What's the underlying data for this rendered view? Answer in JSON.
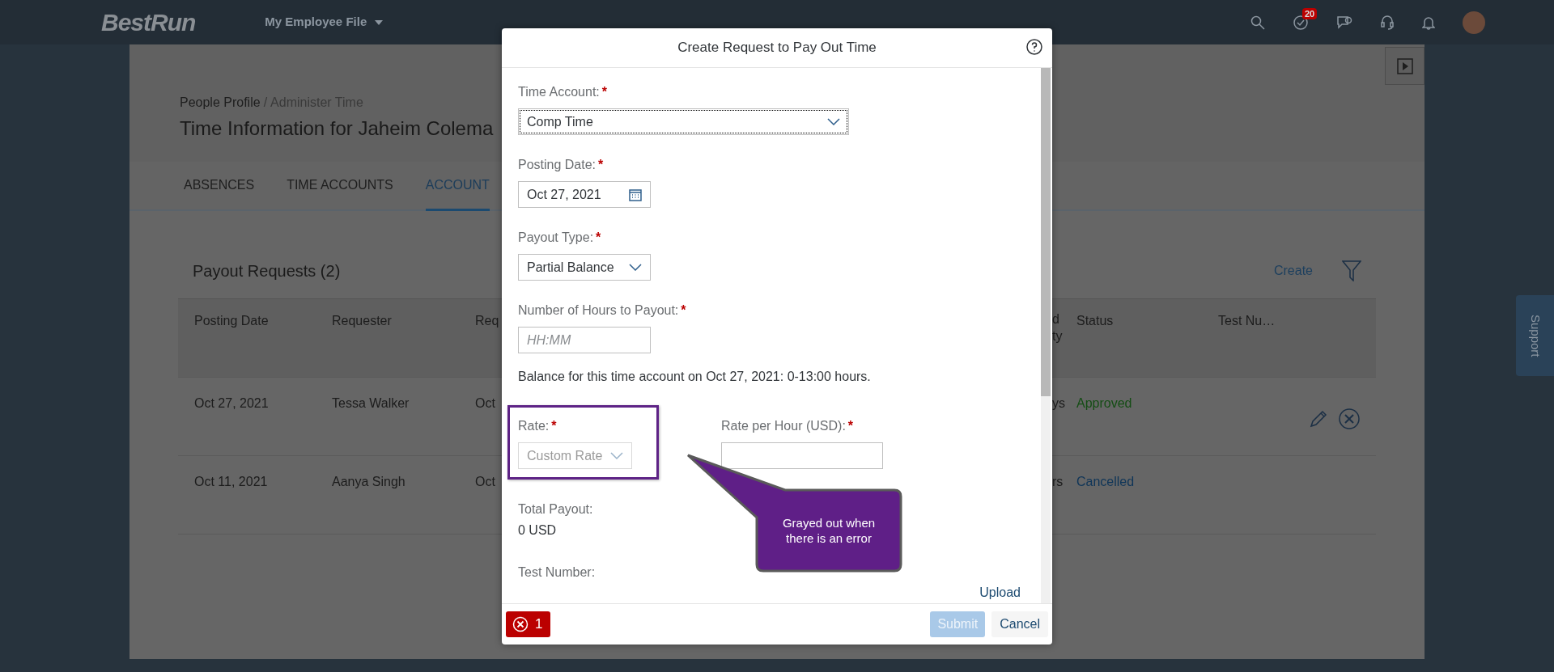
{
  "header": {
    "logo": "BestRun",
    "menu": "My Employee File",
    "tasks_badge": "20"
  },
  "page": {
    "breadcrumb": [
      "People Profile",
      "Administer Time"
    ],
    "breadcrumb_separator": "/",
    "title": "Time Information for Jaheim Colema",
    "tabs": [
      {
        "label": "ABSENCES",
        "selected": false
      },
      {
        "label": "TIME ACCOUNTS",
        "selected": false
      },
      {
        "label": "ACCOUNT",
        "selected": true
      }
    ],
    "section_title": "Payout Requests (2)",
    "create": "Create",
    "table": {
      "columns": [
        "Posting Date",
        "Requester",
        "Req",
        "d ty",
        "Status",
        "Test Nu…"
      ],
      "rows": [
        {
          "cells": [
            "Oct 27, 2021",
            "Tessa Walker",
            "Oct",
            "ys"
          ],
          "status": "Approved",
          "color": "#144d14",
          "actions": true
        },
        {
          "cells": [
            "Oct 11, 2021",
            "Aanya Singh",
            "Oct",
            "rs"
          ],
          "status": "Cancelled",
          "color": "#0f3558"
        }
      ]
    }
  },
  "support": "Support",
  "dialog": {
    "title": "Create Request to Pay Out Time",
    "rows": [
      {
        "fields": [
          {
            "kind": "select",
            "label": "Time Account:",
            "required_mark": "*",
            "value": "Comp Time"
          }
        ]
      },
      {
        "fields": [
          {
            "kind": "date",
            "label": "Posting Date:",
            "required_mark": "*",
            "value": "Oct 27, 2021"
          }
        ]
      },
      {
        "fields": [
          {
            "kind": "select",
            "label": "Payout Type:",
            "required_mark": "*",
            "value": "Partial Balance"
          }
        ]
      },
      {
        "fields": [
          {
            "kind": "text",
            "label": "Number of Hours to Payout:",
            "required_mark": "*",
            "placeholder": "HH:MM"
          }
        ]
      },
      {
        "fields": [
          {
            "kind": "note",
            "text": "Balance for this time account on Oct 27, 2021: 0-13:00 hours."
          }
        ]
      },
      {
        "fields": [
          {
            "kind": "select",
            "label": "Rate:",
            "required_mark": "*",
            "value": "Custom Rate",
            "disabled": true,
            "highlighted": true
          },
          {
            "kind": "text",
            "label": "Rate per Hour (USD):",
            "required_mark": "*"
          }
        ]
      },
      {
        "fields": [
          {
            "kind": "output",
            "label": "Total Payout:",
            "value": "0 USD"
          }
        ]
      },
      {
        "fields": [
          {
            "kind": "output",
            "label": "Test Number:"
          }
        ]
      }
    ],
    "upload": "Upload",
    "error_count": "1",
    "submit": {
      "label": "Submit",
      "disabled": true
    },
    "cancel": "Cancel"
  },
  "annotation": {
    "text": "Grayed out when there is an error"
  }
}
